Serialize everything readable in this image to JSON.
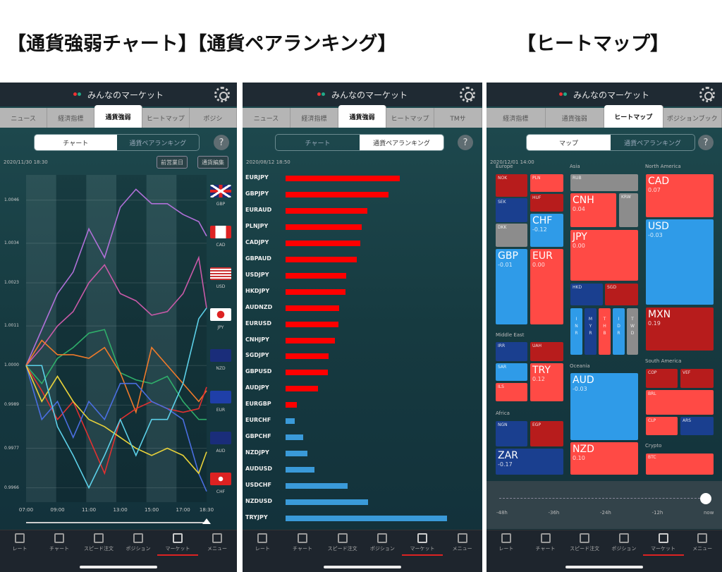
{
  "titles": {
    "left": "【通貨強弱チャート】【通貨ペアランキング】",
    "right": "【ヒートマップ】"
  },
  "app_title": "みんなのマーケット",
  "colors": {
    "up": "#ff4a45",
    "up_strong": "#b71c1c",
    "down": "#2f9be8",
    "down_strong": "#1a3f8f",
    "neutral": "#8c8c8c",
    "rank_up": "#ff0000",
    "rank_down": "#3a9ad9",
    "active_nav": "#dd2222"
  },
  "icons": {
    "settings": "gear-icon",
    "help": "question-icon"
  },
  "bottom_nav": [
    {
      "label": "レート",
      "icon": "rate-icon"
    },
    {
      "label": "チャート",
      "icon": "chart-icon"
    },
    {
      "label": "スピード注文",
      "icon": "speed-order-icon"
    },
    {
      "label": "ポジション",
      "icon": "position-icon"
    },
    {
      "label": "マーケット",
      "icon": "market-icon",
      "active": true
    },
    {
      "label": "メニュー",
      "icon": "menu-icon"
    }
  ],
  "panel1": {
    "tabs": [
      "ニュース",
      "経済指標",
      "通貨強弱",
      "ヒートマップ",
      "ポジシ"
    ],
    "active_tab": 2,
    "segments": [
      "チャート",
      "通貨ペアランキング"
    ],
    "active_segment": 0,
    "timestamp": "2020/11/30 18:30",
    "buttons": {
      "prev_day": "前営業日",
      "edit": "通貨編集"
    },
    "help": "?"
  },
  "panel2": {
    "tabs": [
      "ニュース",
      "経済指標",
      "通貨強弱",
      "ヒートマップ",
      "TMサ"
    ],
    "active_tab": 2,
    "segments": [
      "チャート",
      "通貨ペアランキング"
    ],
    "active_segment": 1,
    "timestamp": "2020/08/12 18:50",
    "help": "?"
  },
  "panel3": {
    "tabs": [
      "経済指標",
      "通貨強弱",
      "ヒートマップ",
      "ポジションブック"
    ],
    "active_tab": 2,
    "segments": [
      "マップ",
      "通貨ペアランキング"
    ],
    "active_segment": 0,
    "timestamp": "2020/12/01 14:00",
    "help": "?",
    "regions": [
      "Europe",
      "Asia",
      "North America",
      "Middle East",
      "Oceania",
      "South America",
      "Africa",
      "Crypto"
    ],
    "tiles": [
      {
        "code": "NOK",
        "level": "up_strong"
      },
      {
        "code": "PLN",
        "level": "up"
      },
      {
        "code": "SEK",
        "level": "down_strong"
      },
      {
        "code": "HUF",
        "level": "up_strong"
      },
      {
        "code": "DKK",
        "level": "neutral"
      },
      {
        "code": "CHF",
        "value": "-0.12",
        "level": "down"
      },
      {
        "code": "GBP",
        "value": "-0.01",
        "level": "down"
      },
      {
        "code": "EUR",
        "value": "0.00",
        "level": "up"
      },
      {
        "code": "RUB",
        "level": "neutral"
      },
      {
        "code": "CNH",
        "value": "0.04",
        "level": "up"
      },
      {
        "code": "KRW",
        "level": "neutral"
      },
      {
        "code": "JPY",
        "value": "0.00",
        "level": "up"
      },
      {
        "code": "HKD",
        "level": "down_strong"
      },
      {
        "code": "SGD",
        "level": "up_strong"
      },
      {
        "code": "INR",
        "level": "down"
      },
      {
        "code": "MYR",
        "level": "down_strong"
      },
      {
        "code": "THB",
        "level": "up"
      },
      {
        "code": "IDR",
        "level": "down"
      },
      {
        "code": "TWD",
        "level": "neutral"
      },
      {
        "code": "CAD",
        "value": "0.07",
        "level": "up"
      },
      {
        "code": "USD",
        "value": "-0.03",
        "level": "down"
      },
      {
        "code": "MXN",
        "value": "0.19",
        "level": "up_strong"
      },
      {
        "code": "IRR",
        "level": "down_strong"
      },
      {
        "code": "UAH",
        "level": "up_strong"
      },
      {
        "code": "SAR",
        "level": "down"
      },
      {
        "code": "TRY",
        "value": "0.12",
        "level": "up"
      },
      {
        "code": "ILS",
        "level": "up"
      },
      {
        "code": "AUD",
        "value": "-0.03",
        "level": "down"
      },
      {
        "code": "NZD",
        "value": "0.10",
        "level": "up"
      },
      {
        "code": "COP",
        "level": "up_strong"
      },
      {
        "code": "VEF",
        "level": "up_strong"
      },
      {
        "code": "BRL",
        "level": "up"
      },
      {
        "code": "CLP",
        "level": "up"
      },
      {
        "code": "ARS",
        "level": "down_strong"
      },
      {
        "code": "NGN",
        "level": "down_strong"
      },
      {
        "code": "EGP",
        "level": "up_strong"
      },
      {
        "code": "ZAR",
        "value": "-0.17",
        "level": "down_strong"
      },
      {
        "code": "BTC",
        "level": "up"
      }
    ],
    "time_slider": {
      "labels": [
        "-48h",
        "-36h",
        "-24h",
        "-12h",
        "now"
      ],
      "selected": "now"
    }
  },
  "chart_data": [
    {
      "type": "line",
      "x": [
        "07:00",
        "08:00",
        "09:00",
        "10:00",
        "11:00",
        "12:00",
        "13:00",
        "14:00",
        "15:00",
        "16:00",
        "17:00",
        "18:00",
        "18:30"
      ],
      "xticks": [
        "07:00",
        "09:00",
        "11:00",
        "13:00",
        "15:00",
        "17:00",
        "18:30"
      ],
      "yticks": [
        "1.0046",
        "1.0034",
        "1.0023",
        "1.0011",
        "1.0000",
        "0.9989",
        "0.9977",
        "0.9966"
      ],
      "ylim": [
        0.9962,
        1.0053
      ],
      "legend": [
        "GBP",
        "CAD",
        "USD",
        "JPY",
        "NZD",
        "EUR",
        "AUD",
        "CHF"
      ],
      "legend_placement": "right",
      "series": [
        {
          "color": "#b070d8",
          "values": [
            1.0,
            1.001,
            1.002,
            1.0026,
            1.0038,
            1.003,
            1.0044,
            1.0049,
            1.0045,
            1.0045,
            1.0042,
            1.004,
            1.0036
          ]
        },
        {
          "color": "#c85aa8",
          "values": [
            1.0,
            1.0005,
            1.0011,
            1.0015,
            1.0023,
            1.0028,
            1.002,
            1.0018,
            1.0014,
            1.0015,
            1.002,
            1.003,
            1.0016
          ]
        },
        {
          "color": "#2fae6a",
          "values": [
            1.0,
            0.9995,
            1.0002,
            1.0005,
            1.0009,
            1.001,
            0.9998,
            0.9996,
            0.9995,
            0.9997,
            0.999,
            0.9985,
            0.9985
          ]
        },
        {
          "color": "#f07a2a",
          "values": [
            1.0,
            1.0007,
            1.0003,
            1.0003,
            1.0002,
            1.0005,
            0.9998,
            0.9987,
            1.0005,
            1.0,
            0.9995,
            0.999,
            0.9993
          ]
        },
        {
          "color": "#e23030",
          "values": [
            1.0,
            0.9993,
            0.9985,
            0.999,
            0.998,
            0.997,
            0.9985,
            0.9988,
            0.999,
            0.9988,
            0.9987,
            0.9988,
            0.9994
          ]
        },
        {
          "color": "#4a6ee0",
          "values": [
            1.0,
            0.9985,
            0.999,
            0.998,
            0.999,
            0.9985,
            0.9995,
            0.9995,
            0.999,
            0.9988,
            0.9985,
            0.997,
            0.9965
          ]
        },
        {
          "color": "#e8d23a",
          "values": [
            1.0,
            0.999,
            0.9997,
            0.999,
            0.9985,
            0.9983,
            0.998,
            0.9977,
            0.9975,
            0.9977,
            0.9975,
            0.997,
            0.9976
          ]
        },
        {
          "color": "#5cd0e8",
          "values": [
            1.0,
            1.0,
            0.9983,
            0.9975,
            0.9966,
            0.9975,
            0.9985,
            0.9975,
            0.9985,
            0.9985,
            0.9995,
            1.0013,
            1.0016
          ]
        }
      ]
    },
    {
      "type": "bar",
      "orientation": "horizontal",
      "categories": [
        "EURJPY",
        "GBPJPY",
        "EURAUD",
        "PLNJPY",
        "CADJPY",
        "GBPAUD",
        "USDJPY",
        "HKDJPY",
        "AUDNZD",
        "EURUSD",
        "CNHJPY",
        "SGDJPY",
        "GBPUSD",
        "AUDJPY",
        "EURGBP",
        "EURCHF",
        "GBPCHF",
        "NZDJPY",
        "AUDUSD",
        "USDCHF",
        "NZDUSD",
        "TRYJPY"
      ],
      "values": [
        162,
        146,
        116,
        108,
        106,
        101,
        86,
        85,
        76,
        75,
        70,
        61,
        60,
        46,
        16,
        -13,
        -25,
        -31,
        -41,
        -88,
        -117,
        -229
      ],
      "value_scale": "relative (no axis printed)"
    }
  ]
}
